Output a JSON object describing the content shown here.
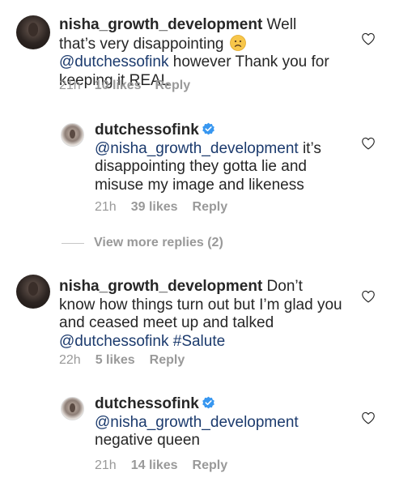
{
  "comments": [
    {
      "user": "nisha_growth_development",
      "text_1": " Well that’s very disappointing ",
      "mention": "@dutchessofink",
      "text_2": " however Thank you for keeping it REAL",
      "time": "21h",
      "likes": "10 likes",
      "reply": "Reply"
    },
    {
      "user": "dutchessofink",
      "verified": true,
      "mention": "@nisha_growth_development",
      "text": " it’s disappointing they gotta lie and misuse my image and likeness",
      "time": "21h",
      "likes": "39 likes",
      "reply": "Reply"
    },
    {
      "user": "nisha_growth_development",
      "text_1": " Don’t know how things turn out but I’m glad you and ceased meet up and talked ",
      "mention": "@dutchessofink",
      "hashtag": "#Salute",
      "time": "22h",
      "likes": "5 likes",
      "reply": "Reply"
    },
    {
      "user": "dutchessofink",
      "verified": true,
      "mention": "@nisha_growth_development",
      "text": " negative queen",
      "time": "21h",
      "likes": "14 likes",
      "reply": "Reply"
    }
  ],
  "view_more_replies": "View more replies (2)",
  "colors": {
    "mention": "#1b3a6d",
    "meta": "#999999",
    "verified": "#3897f0",
    "text": "#262626"
  },
  "icons": [
    "heart-outline-icon",
    "verified-badge-icon",
    "frowning-face-emoji"
  ]
}
